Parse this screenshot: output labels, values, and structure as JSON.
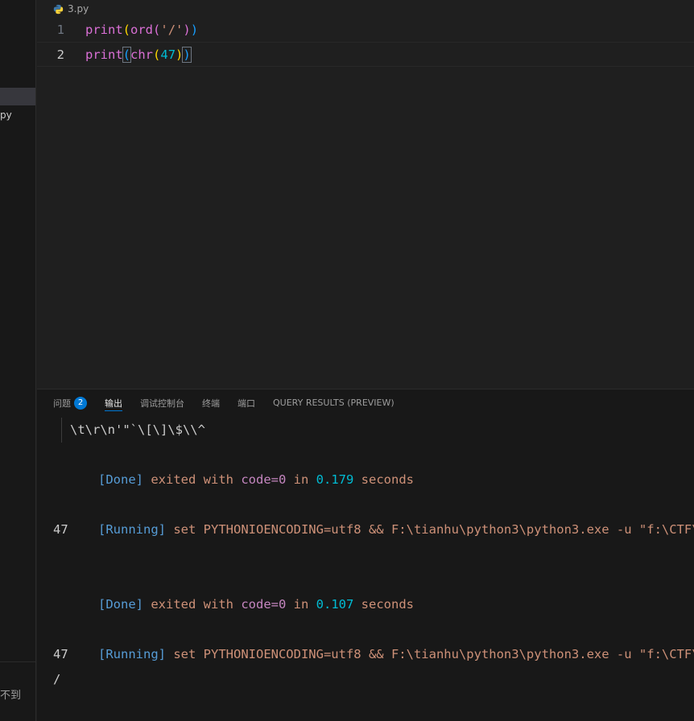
{
  "sidebar": {
    "file_fragment": "py",
    "bottom_text": "不到"
  },
  "editor": {
    "tab_title": "3.py",
    "lines": [
      {
        "number": "1",
        "print": "print",
        "open1": "(",
        "fn": "ord",
        "open2": "(",
        "arg": "'/'",
        "close2": ")",
        "close1": ")"
      },
      {
        "number": "2",
        "print": "print",
        "open1": "(",
        "fn": "chr",
        "open2": "(",
        "arg": "47",
        "close2": ")",
        "close1": ")"
      }
    ]
  },
  "panel": {
    "tabs": {
      "problems": "问题",
      "problems_count": "2",
      "output": "输出",
      "debug_console": "调试控制台",
      "terminal": "终端",
      "ports": "端口",
      "query_results": "QUERY RESULTS (PREVIEW)"
    },
    "output": {
      "line1": "\\t\\r\\n'\"`\\[\\]\\$\\\\^",
      "done1": {
        "tag": "[Done]",
        "text1": " exited with ",
        "code": "code=0",
        "text2": " in ",
        "secs": "0.179",
        "text3": " seconds"
      },
      "running1": {
        "tag": "[Running]",
        "text": " set PYTHONIOENCODING=utf8 && F:\\tianhu\\python3\\python3.exe -u \"f:\\CTF\\"
      },
      "result1": "47",
      "done2": {
        "tag": "[Done]",
        "text1": " exited with ",
        "code": "code=0",
        "text2": " in ",
        "secs": "0.107",
        "text3": " seconds"
      },
      "running2": {
        "tag": "[Running]",
        "text": " set PYTHONIOENCODING=utf8 && F:\\tianhu\\python3\\python3.exe -u \"f:\\CTF\\"
      },
      "result2a": "47",
      "result2b": "/"
    }
  },
  "colors": {
    "background": "#1f1f1f",
    "panel_background": "#181818",
    "accent": "#0078d4"
  }
}
